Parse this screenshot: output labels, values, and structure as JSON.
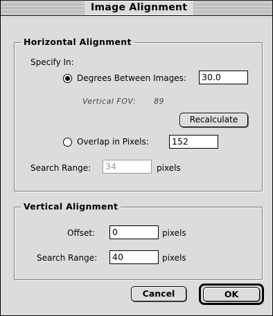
{
  "window": {
    "title": "Image Alignment"
  },
  "horizontal": {
    "heading": "Horizontal Alignment",
    "specify_label": "Specify In:",
    "degrees_label": "Degrees Between Images:",
    "degrees_value": "30.0",
    "degrees_selected": true,
    "fov_label": "Vertical FOV:",
    "fov_value": "89",
    "recalc_label": "Recalculate",
    "overlap_label": "Overlap in Pixels:",
    "overlap_value": "152",
    "overlap_selected": false,
    "search_label": "Search Range:",
    "search_value": "34",
    "search_unit": "pixels"
  },
  "vertical": {
    "heading": "Vertical Alignment",
    "offset_label": "Offset:",
    "offset_value": "0",
    "offset_unit": "pixels",
    "search_label": "Search Range:",
    "search_value": "40",
    "search_unit": "pixels"
  },
  "buttons": {
    "cancel": "Cancel",
    "ok": "OK"
  }
}
